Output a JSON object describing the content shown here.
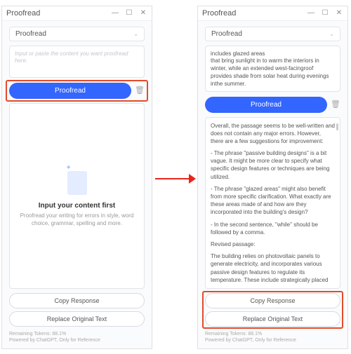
{
  "colors": {
    "primary": "#3365ff",
    "highlight": "#e34b2b"
  },
  "common": {
    "title": "Proofread",
    "dropdown": "Proofread",
    "proofread_btn": "Proofread",
    "copy_btn": "Copy Response",
    "replace_btn": "Replace Original Text",
    "tokens": "Remaining Tokens: 88.1%",
    "powered": "Powered by ChatGPT, Only for Reference"
  },
  "left": {
    "placeholder": "Input or paste the content you want proofread here.",
    "empty_title": "Input your content first",
    "empty_sub": "Proofread your writing for errors in style, word choice, grammar, spelling and more."
  },
  "right": {
    "input_text": "includes glazed areas\nthat bring sunlight in to warm the interiors in winter, while an extended west-facingroof provides shade from solar heat during evenings\ninthe summer.",
    "result": {
      "p1": "Overall, the passage seems to be well-written and does not contain any major errors. However, there are a few suggestions for improvement:",
      "p2": "- The phrase \"passive building designs\" is a bit vague. It might be more clear to specify what specific design features or techniques are being utilized.",
      "p3": "- The phrase \"glazed areas\" might also benefit from more specific clarification. What exactly are these areas made of and how are they incorporated into the building's design?",
      "p4": "- In the second sentence, \"while\" should be followed by a comma.",
      "p5": "Revised passage:",
      "p6": "The building relies on photovoltaic panels to generate electricity, and incorporates various passive design features to regulate its temperature. These include strategically placed glazing to admit sunlight and warm"
    }
  }
}
